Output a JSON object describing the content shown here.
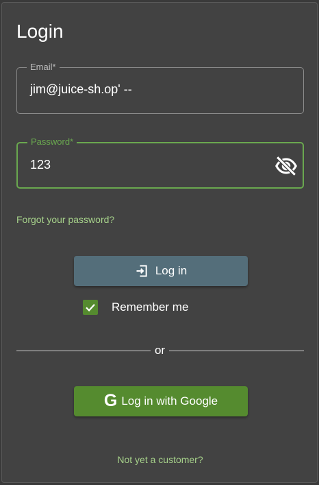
{
  "login": {
    "title": "Login",
    "email": {
      "label": "Email*",
      "value": "jim@juice-sh.op' --"
    },
    "password": {
      "label": "Password*",
      "value": "123",
      "toggle_icon": "eye-off-icon"
    },
    "forgot_link": "Forgot your password?",
    "login_button": {
      "label": "Log in",
      "icon": "login-icon"
    },
    "remember_me": {
      "label": "Remember me",
      "checked": true
    },
    "divider_text": "or",
    "google_button": {
      "label": "Log in with Google",
      "icon": "google-icon",
      "glyph": "G"
    },
    "customer_link": "Not yet a customer?"
  },
  "colors": {
    "card_bg": "#424242",
    "accent_green": "#558b2f",
    "focus_green": "#6aa84f",
    "link_green": "#a6d18a",
    "login_button_bg": "#546e7a"
  }
}
